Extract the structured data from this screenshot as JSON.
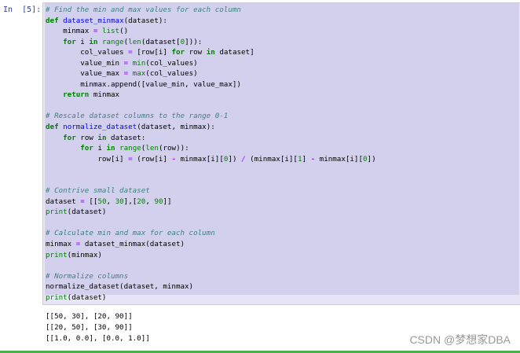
{
  "cell": {
    "prompt": "In  [5]:",
    "code_lines": [
      [
        [
          "c",
          "# Find the min and max values for each column"
        ]
      ],
      [
        [
          "k",
          "def"
        ],
        [
          "x",
          " "
        ],
        [
          "f",
          "dataset_minmax"
        ],
        [
          "x",
          "(dataset):"
        ]
      ],
      [
        [
          "x",
          "    minmax "
        ],
        [
          "o",
          "="
        ],
        [
          "x",
          " "
        ],
        [
          "b",
          "list"
        ],
        [
          "x",
          "()"
        ]
      ],
      [
        [
          "x",
          "    "
        ],
        [
          "k",
          "for"
        ],
        [
          "x",
          " i "
        ],
        [
          "k",
          "in"
        ],
        [
          "x",
          " "
        ],
        [
          "b",
          "range"
        ],
        [
          "x",
          "("
        ],
        [
          "b",
          "len"
        ],
        [
          "x",
          "(dataset["
        ],
        [
          "n",
          "0"
        ],
        [
          "x",
          "])):"
        ]
      ],
      [
        [
          "x",
          "        col_values "
        ],
        [
          "o",
          "="
        ],
        [
          "x",
          " [row[i] "
        ],
        [
          "k",
          "for"
        ],
        [
          "x",
          " row "
        ],
        [
          "k",
          "in"
        ],
        [
          "x",
          " dataset]"
        ]
      ],
      [
        [
          "x",
          "        value_min "
        ],
        [
          "o",
          "="
        ],
        [
          "x",
          " "
        ],
        [
          "b",
          "min"
        ],
        [
          "x",
          "(col_values)"
        ]
      ],
      [
        [
          "x",
          "        value_max "
        ],
        [
          "o",
          "="
        ],
        [
          "x",
          " "
        ],
        [
          "b",
          "max"
        ],
        [
          "x",
          "(col_values)"
        ]
      ],
      [
        [
          "x",
          "        minmax.append([value_min, value_max])"
        ]
      ],
      [
        [
          "x",
          "    "
        ],
        [
          "k",
          "return"
        ],
        [
          "x",
          " minmax"
        ]
      ],
      [
        [
          "x",
          ""
        ]
      ],
      [
        [
          "c",
          "# Rescale dataset columns to the range 0-1"
        ]
      ],
      [
        [
          "k",
          "def"
        ],
        [
          "x",
          " "
        ],
        [
          "f",
          "normalize_dataset"
        ],
        [
          "x",
          "(dataset, minmax):"
        ]
      ],
      [
        [
          "x",
          "    "
        ],
        [
          "k",
          "for"
        ],
        [
          "x",
          " row "
        ],
        [
          "k",
          "in"
        ],
        [
          "x",
          " dataset:"
        ]
      ],
      [
        [
          "x",
          "        "
        ],
        [
          "k",
          "for"
        ],
        [
          "x",
          " i "
        ],
        [
          "k",
          "in"
        ],
        [
          "x",
          " "
        ],
        [
          "b",
          "range"
        ],
        [
          "x",
          "("
        ],
        [
          "b",
          "len"
        ],
        [
          "x",
          "(row)):"
        ]
      ],
      [
        [
          "x",
          "            row[i] "
        ],
        [
          "o",
          "="
        ],
        [
          "x",
          " (row[i] "
        ],
        [
          "o",
          "-"
        ],
        [
          "x",
          " minmax[i]["
        ],
        [
          "n",
          "0"
        ],
        [
          "x",
          "]) "
        ],
        [
          "o",
          "/"
        ],
        [
          "x",
          " (minmax[i]["
        ],
        [
          "n",
          "1"
        ],
        [
          "x",
          "] "
        ],
        [
          "o",
          "-"
        ],
        [
          "x",
          " minmax[i]["
        ],
        [
          "n",
          "0"
        ],
        [
          "x",
          "])"
        ]
      ],
      [
        [
          "x",
          ""
        ]
      ],
      [
        [
          "x",
          ""
        ]
      ],
      [
        [
          "c",
          "# Contrive small dataset"
        ]
      ],
      [
        [
          "x",
          "dataset "
        ],
        [
          "o",
          "="
        ],
        [
          "x",
          " [["
        ],
        [
          "n",
          "50"
        ],
        [
          "x",
          ", "
        ],
        [
          "n",
          "30"
        ],
        [
          "x",
          "],["
        ],
        [
          "n",
          "20"
        ],
        [
          "x",
          ", "
        ],
        [
          "n",
          "90"
        ],
        [
          "x",
          "]]"
        ]
      ],
      [
        [
          "b",
          "print"
        ],
        [
          "x",
          "(dataset)"
        ]
      ],
      [
        [
          "x",
          ""
        ]
      ],
      [
        [
          "c",
          "# Calculate min and max for each column"
        ]
      ],
      [
        [
          "x",
          "minmax "
        ],
        [
          "o",
          "="
        ],
        [
          "x",
          " dataset_minmax(dataset)"
        ]
      ],
      [
        [
          "b",
          "print"
        ],
        [
          "x",
          "(minmax)"
        ]
      ],
      [
        [
          "x",
          ""
        ]
      ],
      [
        [
          "c",
          "# Normalize columns"
        ]
      ],
      [
        [
          "x",
          "normalize_dataset(dataset, minmax)"
        ]
      ],
      [
        [
          "b",
          "print"
        ],
        [
          "x",
          "(dataset)"
        ]
      ]
    ],
    "output_lines": [
      "[[50, 30], [20, 90]]",
      "[[20, 50], [30, 90]]",
      "[[1.0, 0.0], [0.0, 1.0]]"
    ]
  },
  "watermark": "CSDN @梦想家DBA"
}
